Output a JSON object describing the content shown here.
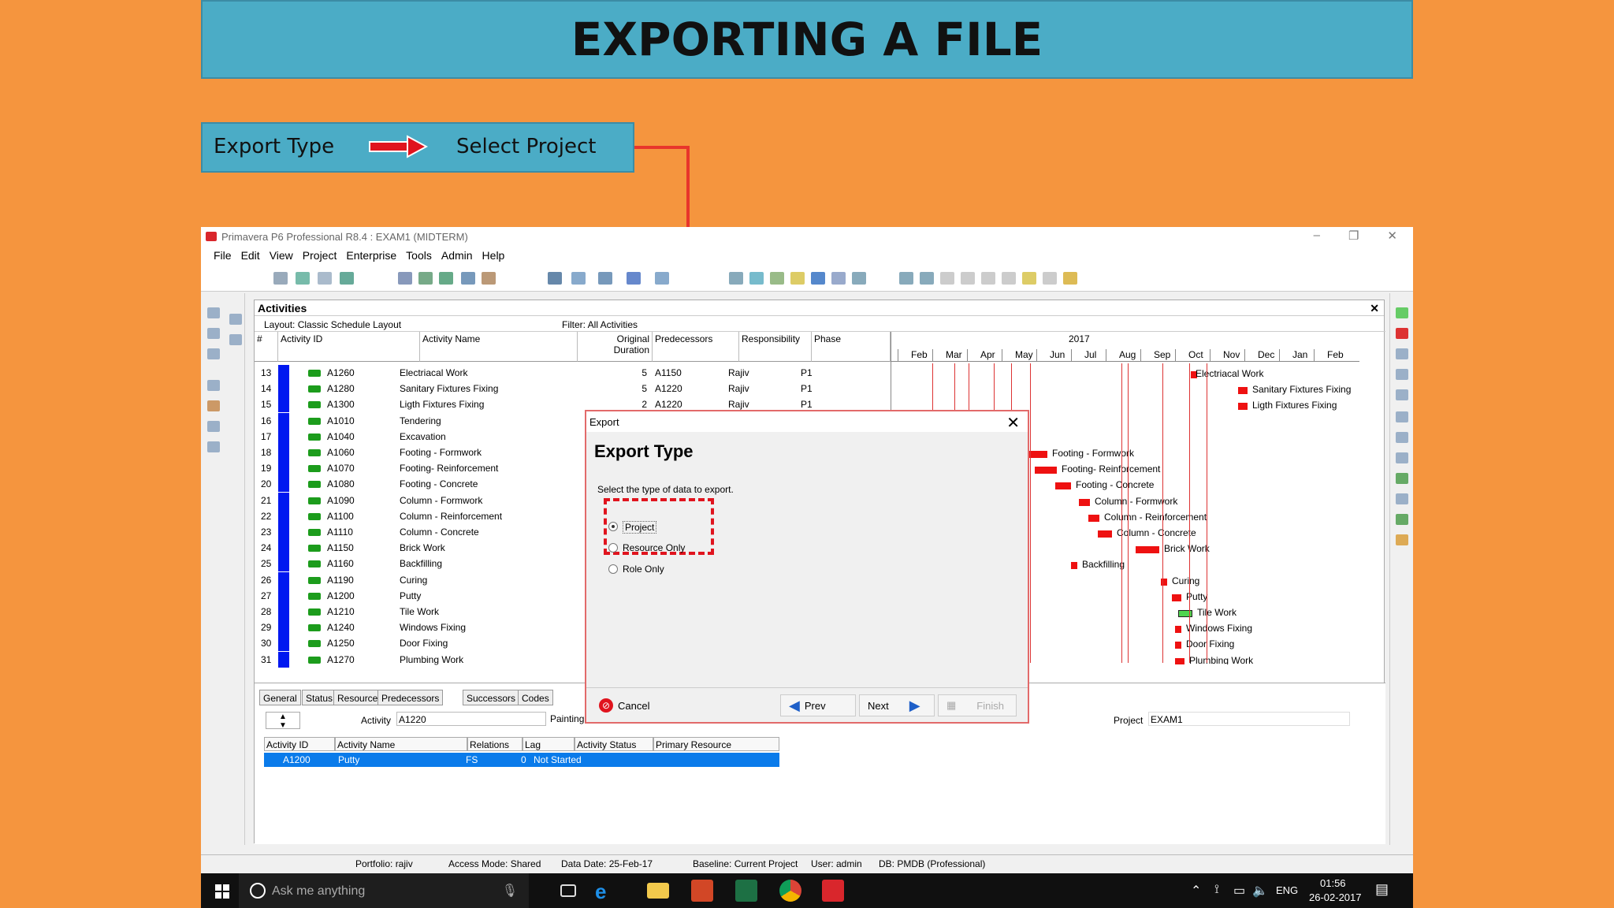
{
  "banner": {
    "title": "EXPORTING A FILE"
  },
  "flow": {
    "step1": "Export Type",
    "step2": "Select Project"
  },
  "app": {
    "title": "Primavera P6 Professional R8.4 : EXAM1 (MIDTERM)",
    "menu": [
      "File",
      "Edit",
      "View",
      "Project",
      "Enterprise",
      "Tools",
      "Admin",
      "Help"
    ],
    "panel_title": "Activities",
    "layout_label": "Layout: Classic Schedule Layout",
    "filter_label": "Filter: All Activities",
    "columns": {
      "num": "#",
      "id": "Activity ID",
      "name": "Activity Name",
      "dur": "Original Duration",
      "pred": "Predecessors",
      "resp": "Responsibility",
      "phase": "Phase"
    },
    "rows": [
      {
        "n": "13",
        "id": "A1260",
        "name": "Electriacal Work",
        "dur": "5",
        "pred": "A1150",
        "resp": "Rajiv",
        "phase": "P1"
      },
      {
        "n": "14",
        "id": "A1280",
        "name": "Sanitary Fixtures Fixing",
        "dur": "5",
        "pred": "A1220",
        "resp": "Rajiv",
        "phase": "P1"
      },
      {
        "n": "15",
        "id": "A1300",
        "name": "Ligth Fixtures Fixing",
        "dur": "2",
        "pred": "A1220",
        "resp": "Rajiv",
        "phase": "P1"
      },
      {
        "n": "16",
        "id": "A1010",
        "name": "Tendering"
      },
      {
        "n": "17",
        "id": "A1040",
        "name": "Excavation"
      },
      {
        "n": "18",
        "id": "A1060",
        "name": "Footing - Formwork"
      },
      {
        "n": "19",
        "id": "A1070",
        "name": "Footing- Reinforcement"
      },
      {
        "n": "20",
        "id": "A1080",
        "name": "Footing - Concrete"
      },
      {
        "n": "21",
        "id": "A1090",
        "name": "Column - Formwork"
      },
      {
        "n": "22",
        "id": "A1100",
        "name": "Column - Reinforcement"
      },
      {
        "n": "23",
        "id": "A1110",
        "name": "Column - Concrete"
      },
      {
        "n": "24",
        "id": "A1150",
        "name": "Brick Work"
      },
      {
        "n": "25",
        "id": "A1160",
        "name": "Backfilling"
      },
      {
        "n": "26",
        "id": "A1190",
        "name": "Curing"
      },
      {
        "n": "27",
        "id": "A1200",
        "name": "Putty"
      },
      {
        "n": "28",
        "id": "A1210",
        "name": "Tile Work"
      },
      {
        "n": "29",
        "id": "A1240",
        "name": "Windows Fixing"
      },
      {
        "n": "30",
        "id": "A1250",
        "name": "Door Fixing"
      },
      {
        "n": "31",
        "id": "A1270",
        "name": "Plumbing Work"
      }
    ],
    "gantt": {
      "year": "2017",
      "months": [
        "Feb",
        "Mar",
        "Apr",
        "May",
        "Jun",
        "Jul",
        "Aug",
        "Sep",
        "Oct",
        "Nov",
        "Dec",
        "Jan",
        "Feb"
      ],
      "labels": [
        "Electriacal Work",
        "Sanitary Fixtures Fixing",
        "Ligth Fixtures Fixing",
        "g",
        "xcavation",
        "Footing - Formwork",
        "Footing- Reinforcement",
        "Footing - Concrete",
        "Column - Formwork",
        "Column - Reinforcement",
        "Column - Concrete",
        "Brick Work",
        "Backfilling",
        "Curing",
        "Putty",
        "Tile Work",
        "Windows Fixing",
        "Door Fixing",
        "Plumbing Work"
      ]
    },
    "bottom": {
      "tabs": [
        "General",
        "Status",
        "Resources",
        "Predecessors",
        "Successors",
        "Codes"
      ],
      "activity_label": "Activity",
      "activity_value": "A1220",
      "activity_name": "Painting - Internal",
      "project_label": "Project",
      "project_value": "EXAM1",
      "cols": [
        "Activity ID",
        "Activity Name",
        "Relations",
        "Lag",
        "Activity Status",
        "Primary Resource"
      ],
      "row": {
        "id": "A1200",
        "name": "Putty",
        "rel": "FS",
        "lag": "0",
        "status": "Not Started",
        "res": ""
      }
    },
    "status": {
      "portfolio": "Portfolio: rajiv",
      "access": "Access Mode: Shared",
      "date": "Data Date: 25-Feb-17",
      "baseline": "Baseline: Current Project",
      "user": "User: admin",
      "db": "DB: PMDB (Professional)"
    }
  },
  "dialog": {
    "title": "Export",
    "header": "Export Type",
    "prompt": "Select the type of data to export.",
    "options": [
      "Project",
      "Resource Only",
      "Role Only"
    ],
    "cancel": "Cancel",
    "prev": "Prev",
    "next": "Next",
    "finish": "Finish"
  },
  "taskbar": {
    "search": "Ask me anything",
    "lang": "ENG",
    "time": "01:56",
    "date": "26-02-2017"
  }
}
